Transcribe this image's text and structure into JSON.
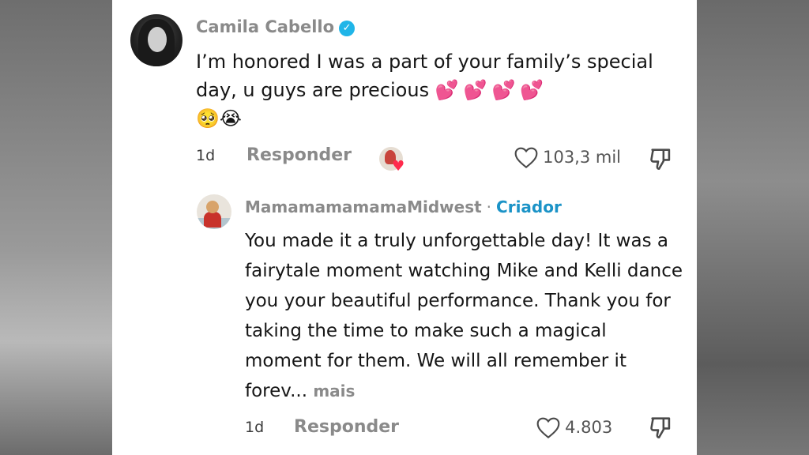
{
  "comment": {
    "author": "Camila Cabello",
    "verified_icon": "verified-check-icon",
    "text": "I’m honored I was a part of your family’s special day, u guys are precious",
    "emoji_hearts": "💕💕💕💕",
    "emoji_faces": "🥺😭",
    "time": "1d",
    "reply_label": "Responder",
    "likes": "103,3 mil",
    "creator_liked_icon": "red-heart-icon"
  },
  "reply": {
    "author": "MamamamamamaMidwest",
    "separator": "·",
    "badge": "Criador",
    "text": "You made it a truly unforgettable day! It was a fairytale moment watching Mike and Kelli dance you your beautiful performance. Thank you for taking the time to make such a magical moment for them. We will all remember it forev...",
    "more_label": "mais",
    "time": "1d",
    "reply_label": "Responder",
    "likes": "4.803"
  },
  "colors": {
    "verified": "#20b5e8",
    "creator": "#1b93c7",
    "muted": "#8a8a8a",
    "heart": "#f03fa8"
  }
}
